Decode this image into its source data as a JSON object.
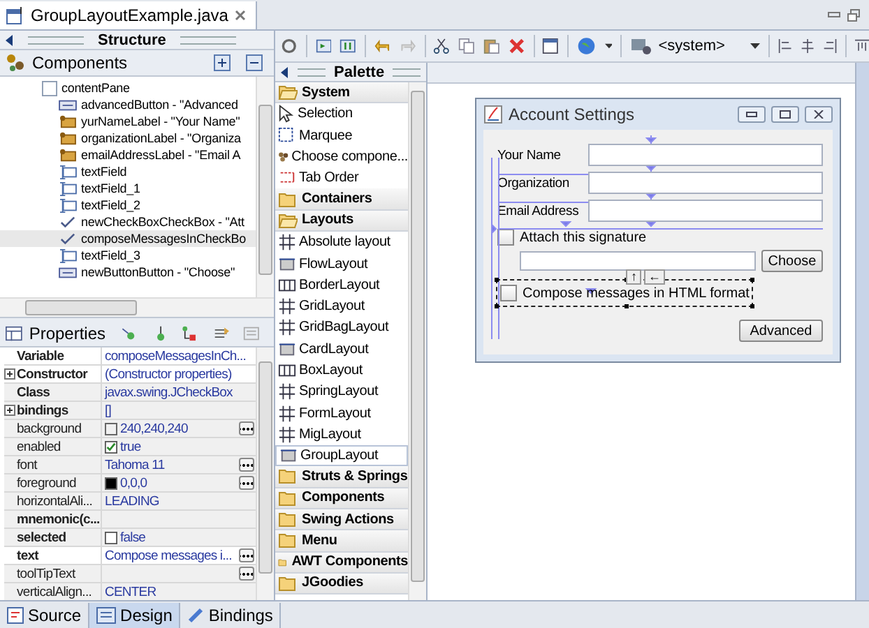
{
  "editor_tab": {
    "title": "GroupLayoutExample.java",
    "selected": true
  },
  "structure": {
    "title": "Structure",
    "components_title": "Components",
    "tree": [
      {
        "label": "contentPane",
        "kind": "panel",
        "selected": false,
        "children": [
          {
            "label": "advancedButton - \"Advanced",
            "kind": "button",
            "selected": false
          },
          {
            "label": "yurNameLabel - \"Your Name\"",
            "kind": "label",
            "selected": false
          },
          {
            "label": "organizationLabel - \"Organiza",
            "kind": "label",
            "selected": false
          },
          {
            "label": "emailAddressLabel - \"Email A",
            "kind": "label",
            "selected": false
          },
          {
            "label": "textField",
            "kind": "textfield",
            "selected": false
          },
          {
            "label": "textField_1",
            "kind": "textfield",
            "selected": false
          },
          {
            "label": "textField_2",
            "kind": "textfield",
            "selected": false
          },
          {
            "label": "newCheckBoxCheckBox - \"Att",
            "kind": "checkbox",
            "selected": false
          },
          {
            "label": "composeMessagesInCheckBo",
            "kind": "checkbox",
            "selected": true
          },
          {
            "label": "textField_3",
            "kind": "textfield",
            "selected": false
          },
          {
            "label": "newButtonButton - \"Choose\"",
            "kind": "button",
            "selected": false
          }
        ]
      }
    ]
  },
  "properties": {
    "title": "Properties",
    "rows": [
      {
        "name": "Variable",
        "bold": true,
        "highlighted": true,
        "kind": "text",
        "value": "composeMessagesInCh..."
      },
      {
        "name": "Constructor",
        "bold": true,
        "expandable": true,
        "highlighted": true,
        "kind": "text",
        "value": "(Constructor properties)"
      },
      {
        "name": "Class",
        "bold": true,
        "highlighted": false,
        "kind": "text",
        "value": "javax.swing.JCheckBox"
      },
      {
        "name": "bindings",
        "bold": true,
        "expandable": true,
        "highlighted": false,
        "kind": "text",
        "value": "[]"
      },
      {
        "name": "background",
        "bold": false,
        "highlighted": false,
        "kind": "color",
        "color": "#f0f0f0",
        "value": "240,240,240",
        "edit_button": true
      },
      {
        "name": "enabled",
        "bold": false,
        "highlighted": false,
        "kind": "check",
        "checked": true,
        "value": "true"
      },
      {
        "name": "font",
        "bold": false,
        "highlighted": false,
        "kind": "text",
        "value": "Tahoma 11",
        "edit_button": true
      },
      {
        "name": "foreground",
        "bold": false,
        "highlighted": false,
        "kind": "color",
        "color": "#000000",
        "value": "0,0,0",
        "edit_button": true
      },
      {
        "name": "horizontalAli...",
        "bold": false,
        "highlighted": false,
        "kind": "text",
        "value": "LEADING"
      },
      {
        "name": "mnemonic(c...",
        "bold": true,
        "highlighted": false,
        "kind": "text"
      },
      {
        "name": "selected",
        "bold": true,
        "highlighted": false,
        "kind": "check",
        "checked": false,
        "value": "false"
      },
      {
        "name": "text",
        "bold": true,
        "highlighted": true,
        "kind": "text",
        "value": "Compose messages i...",
        "edit_button": true
      },
      {
        "name": "toolTipText",
        "bold": false,
        "highlighted": false,
        "kind": "text",
        "edit_button": true
      },
      {
        "name": "verticalAlign...",
        "bold": false,
        "highlighted": false,
        "kind": "text",
        "value": "CENTER"
      }
    ]
  },
  "toolbar": {
    "look_and_feel": "<system>"
  },
  "palette": {
    "title": "Palette",
    "items": [
      {
        "label": "System",
        "kind": "category",
        "expanded": true
      },
      {
        "label": "Selection",
        "kind": "tool",
        "selected": false
      },
      {
        "label": "Marquee",
        "kind": "tool",
        "selected": false
      },
      {
        "label": "Choose compone...",
        "kind": "tool",
        "selected": false
      },
      {
        "label": "Tab Order",
        "kind": "tool",
        "selected": false
      },
      {
        "label": "Containers",
        "kind": "category",
        "expanded": false
      },
      {
        "label": "Layouts",
        "kind": "category",
        "expanded": true
      },
      {
        "label": "Absolute layout",
        "kind": "tool",
        "selected": false
      },
      {
        "label": "FlowLayout",
        "kind": "tool",
        "selected": false
      },
      {
        "label": "BorderLayout",
        "kind": "tool",
        "selected": false
      },
      {
        "label": "GridLayout",
        "kind": "tool",
        "selected": false
      },
      {
        "label": "GridBagLayout",
        "kind": "tool",
        "selected": false
      },
      {
        "label": "CardLayout",
        "kind": "tool",
        "selected": false
      },
      {
        "label": "BoxLayout",
        "kind": "tool",
        "selected": false
      },
      {
        "label": "SpringLayout",
        "kind": "tool",
        "selected": false
      },
      {
        "label": "FormLayout",
        "kind": "tool",
        "selected": false
      },
      {
        "label": "MigLayout",
        "kind": "tool",
        "selected": false
      },
      {
        "label": "GroupLayout",
        "kind": "tool",
        "selected": true
      },
      {
        "label": "Struts & Springs",
        "kind": "category",
        "expanded": false
      },
      {
        "label": "Components",
        "kind": "category",
        "expanded": false
      },
      {
        "label": "Swing Actions",
        "kind": "category",
        "expanded": false
      },
      {
        "label": "Menu",
        "kind": "category",
        "expanded": false
      },
      {
        "label": "AWT Components",
        "kind": "category",
        "expanded": false
      },
      {
        "label": "JGoodies",
        "kind": "category",
        "expanded": false
      }
    ]
  },
  "form": {
    "title": "Account Settings",
    "fields": [
      {
        "label": "Your Name"
      },
      {
        "label": "Organization"
      },
      {
        "label": "Email Address"
      }
    ],
    "attach_checkbox": {
      "label": "Attach this signature",
      "checked": false
    },
    "choose_button": "Choose",
    "compose_checkbox": {
      "label": "Compose messages in HTML format",
      "checked": false,
      "selected": true
    },
    "anchor_buttons": [
      "↑",
      "←"
    ],
    "advanced_button": "Advanced"
  },
  "bottom_tabs": [
    {
      "label": "Source",
      "selected": false
    },
    {
      "label": "Design",
      "selected": true
    },
    {
      "label": "Bindings",
      "selected": false
    }
  ]
}
